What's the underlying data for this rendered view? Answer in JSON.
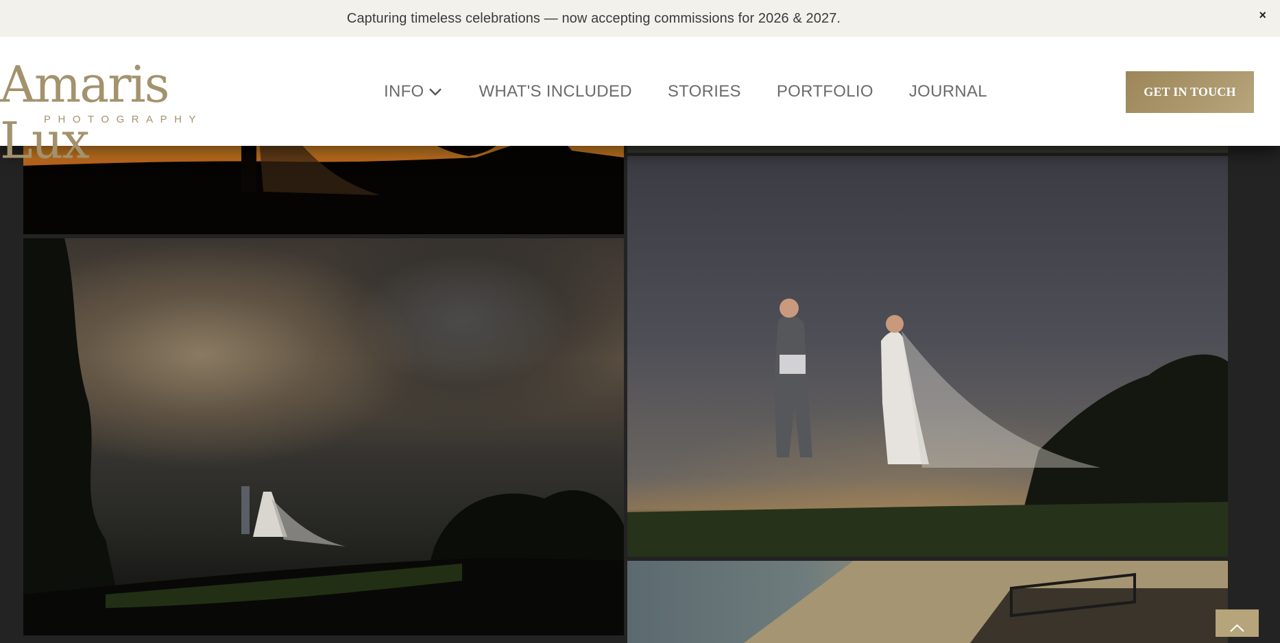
{
  "announcement": {
    "text": "Capturing timeless celebrations — now accepting commissions for 2026 & 2027.",
    "close_label": "×"
  },
  "brand": {
    "name": "Amaris Lux",
    "tagline": "PHOTOGRAPHY",
    "color": "#a3926c"
  },
  "nav": {
    "items": [
      {
        "label": "INFO",
        "has_dropdown": true
      },
      {
        "label": "WHAT'S INCLUDED"
      },
      {
        "label": "STORIES"
      },
      {
        "label": "PORTFOLIO"
      },
      {
        "label": "JOURNAL"
      }
    ],
    "dropdown_icon": "chevron-down-icon"
  },
  "cta": {
    "label": "GET IN TOUCH",
    "color": "#a89468"
  },
  "gallery": {
    "photos": [
      {
        "name": "sunset-silhouette-photo"
      },
      {
        "name": "top-right-photo"
      },
      {
        "name": "stormy-sky-couple-photo"
      },
      {
        "name": "couple-hilltop-photo"
      },
      {
        "name": "building-balcony-photo"
      }
    ]
  },
  "scroll_top": {
    "icon": "chevron-up-icon",
    "color": "#b6a47a"
  }
}
